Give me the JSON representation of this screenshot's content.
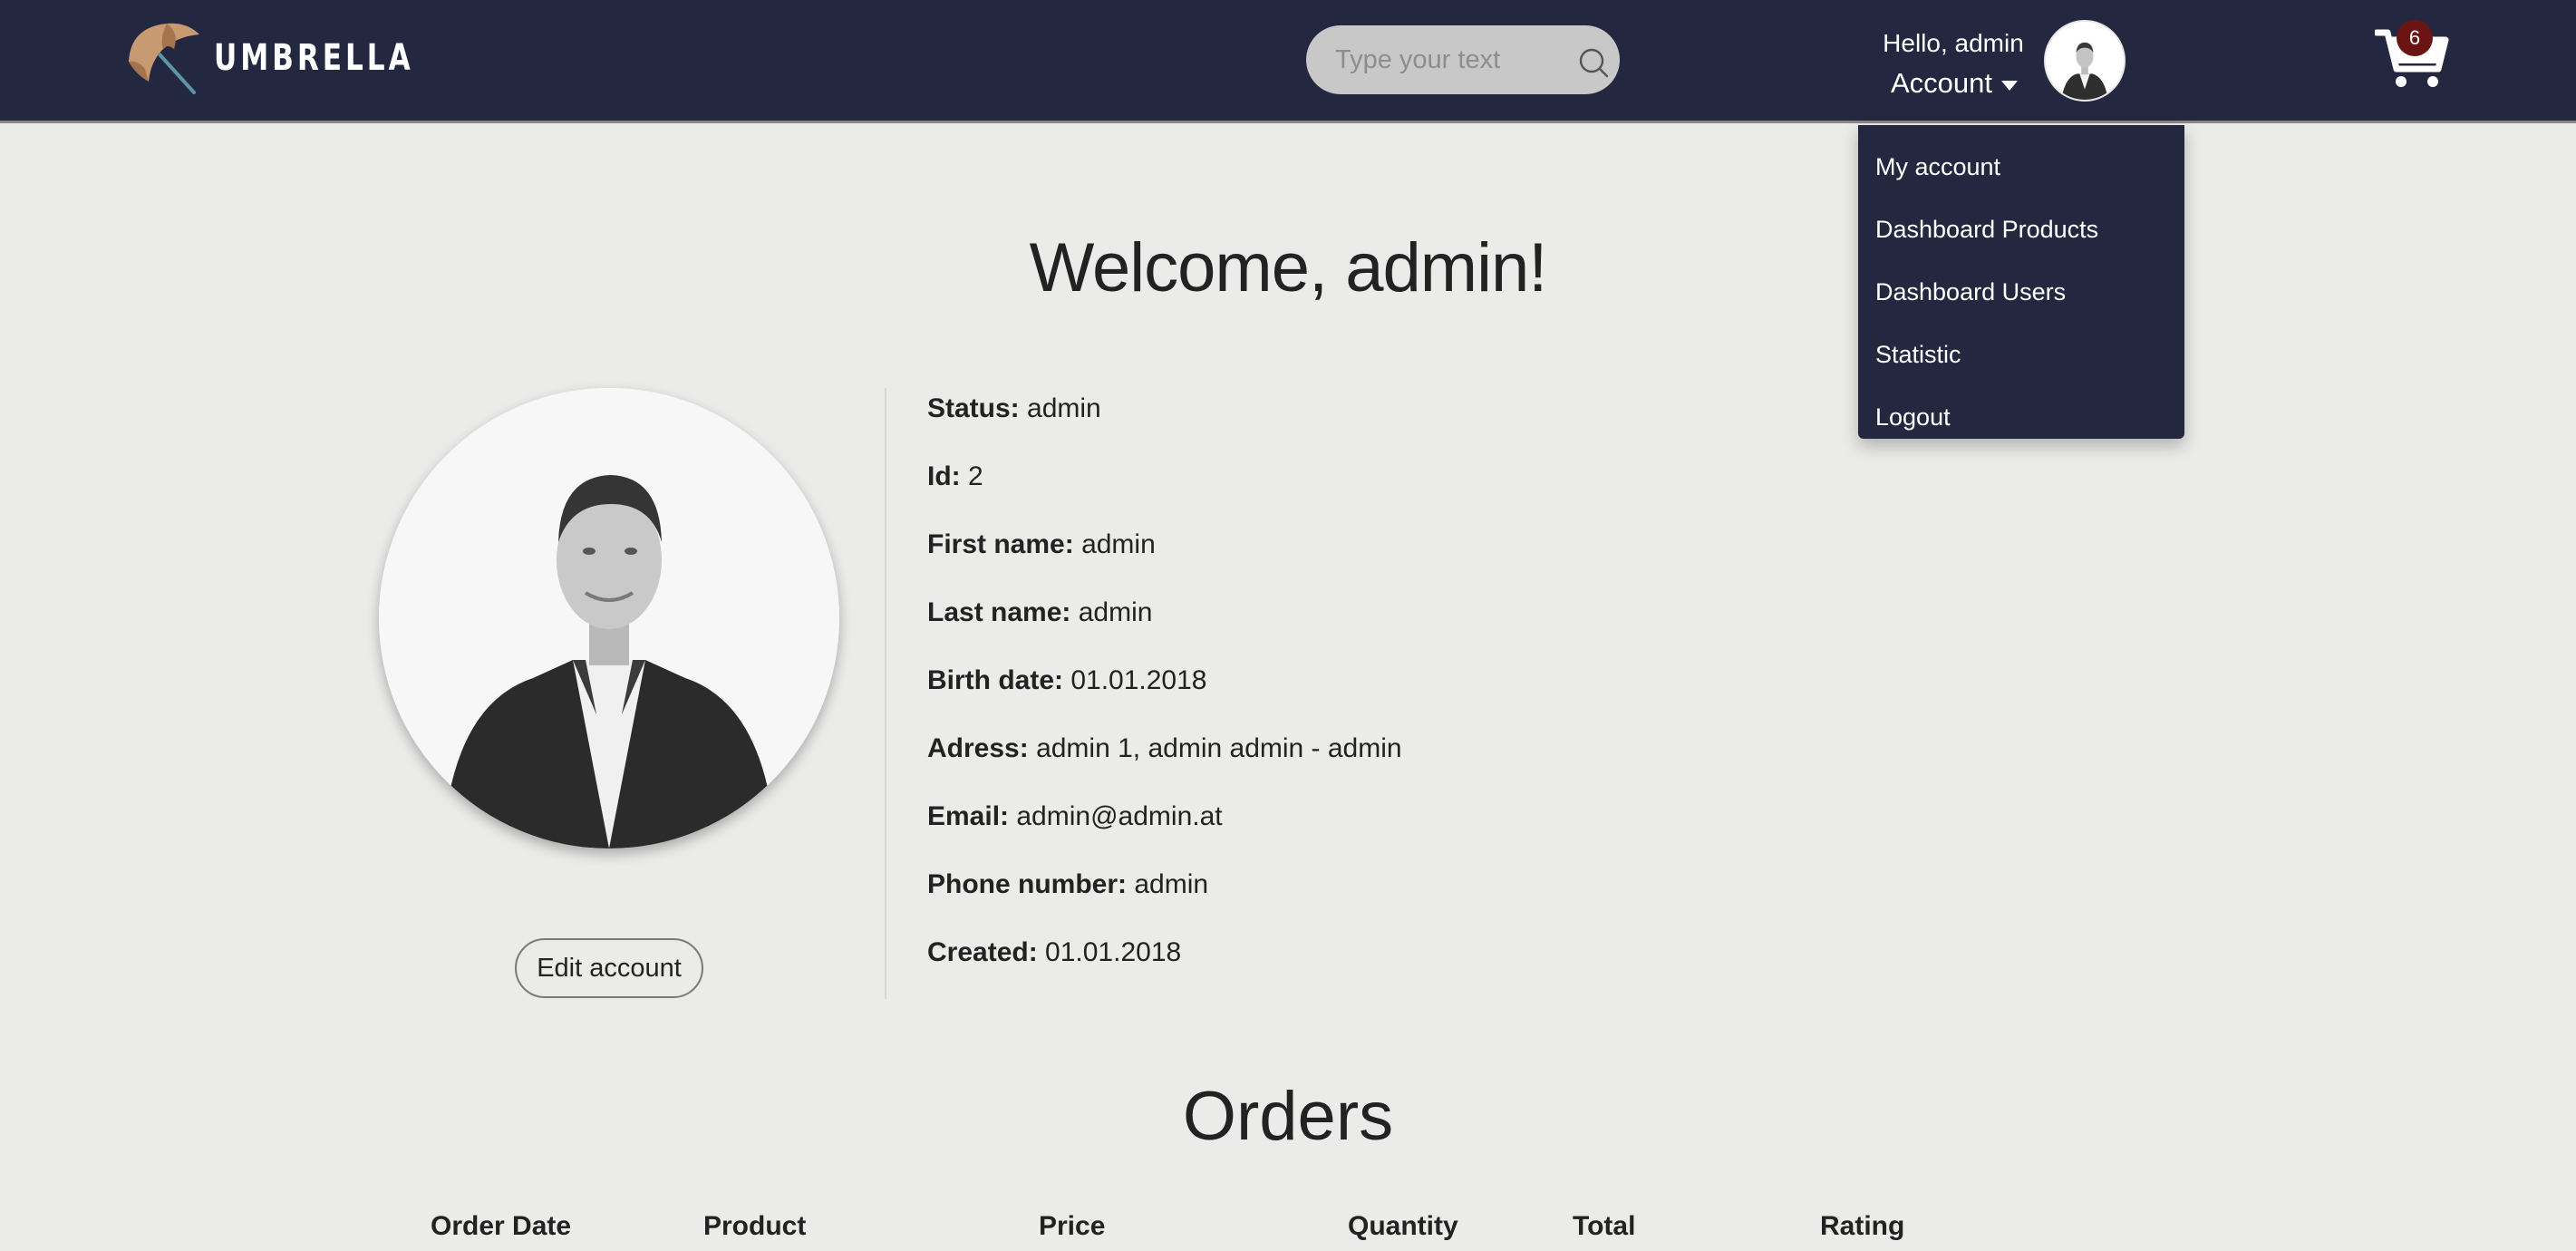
{
  "header": {
    "brand": "UMBRELLA",
    "search_placeholder": "Type your text",
    "greeting": "Hello, admin",
    "account_label": "Account",
    "cart_count": "6"
  },
  "account_menu": {
    "items": [
      "My account",
      "Dashboard Products",
      "Dashboard Users",
      "Statistic",
      "Logout"
    ]
  },
  "profile": {
    "welcome": "Welcome, admin!",
    "edit_label": "Edit account",
    "fields": [
      {
        "label": "Status:",
        "value": "admin"
      },
      {
        "label": "Id:",
        "value": "2"
      },
      {
        "label": "First name:",
        "value": "admin"
      },
      {
        "label": "Last name:",
        "value": "admin"
      },
      {
        "label": "Birth date:",
        "value": "01.01.2018"
      },
      {
        "label": "Adress:",
        "value": "admin 1, admin admin - admin"
      },
      {
        "label": "Email:",
        "value": "admin@admin.at"
      },
      {
        "label": "Phone number:",
        "value": "admin"
      },
      {
        "label": "Created:",
        "value": "01.01.2018"
      }
    ]
  },
  "orders": {
    "title": "Orders",
    "columns": [
      "Order Date",
      "Product",
      "Price",
      "Quantity",
      "Total",
      "Rating"
    ]
  },
  "colors": {
    "header_bg": "#232840",
    "page_bg": "#ebebe9",
    "badge_bg": "#6b1414"
  }
}
